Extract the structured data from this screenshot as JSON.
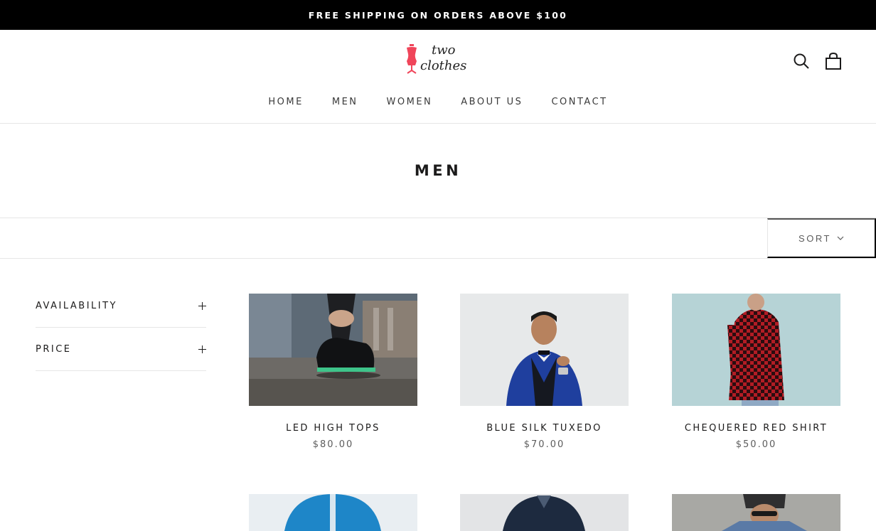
{
  "announcement": "FREE SHIPPING ON ORDERS ABOVE $100",
  "logo": {
    "line1": "two",
    "line2": "clothes"
  },
  "nav": [
    "HOME",
    "MEN",
    "WOMEN",
    "ABOUT US",
    "CONTACT"
  ],
  "page_title": "MEN",
  "sort_label": "SORT",
  "filters": [
    "AVAILABILITY",
    "PRICE"
  ],
  "products": [
    {
      "name": "LED HIGH TOPS",
      "price": "$80.00"
    },
    {
      "name": "BLUE SILK TUXEDO",
      "price": "$70.00"
    },
    {
      "name": "CHEQUERED RED SHIRT",
      "price": "$50.00"
    }
  ],
  "icons": {
    "search": "search-icon",
    "cart": "shopping-bag-icon",
    "sort": "chevron-down-icon",
    "filter": "plus-icon"
  },
  "colors": {
    "announcement_bg": "#000000",
    "logo_accent": "#f0455a",
    "text": "#1c1b1b"
  }
}
